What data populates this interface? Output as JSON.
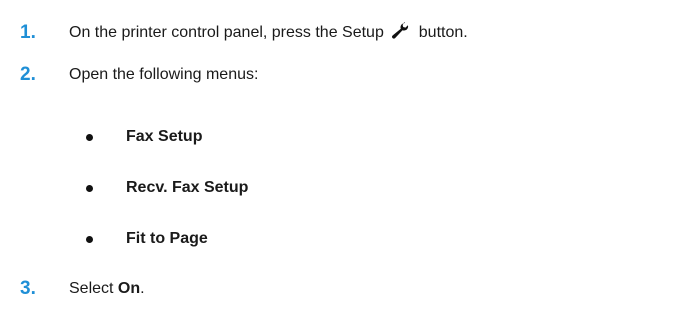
{
  "steps": [
    {
      "number": "1.",
      "text_before": "On the printer control panel, press the Setup",
      "icon": "wrench-icon",
      "text_after": "button."
    },
    {
      "number": "2.",
      "text": "Open the following menus:"
    },
    {
      "number": "3.",
      "text_before": "Select",
      "bold": "On",
      "text_after": "."
    }
  ],
  "menus": [
    "Fax Setup",
    "Recv. Fax Setup",
    "Fit to Page"
  ],
  "colors": {
    "step_number": "#1f8fd6",
    "text": "#1a1a1a"
  }
}
